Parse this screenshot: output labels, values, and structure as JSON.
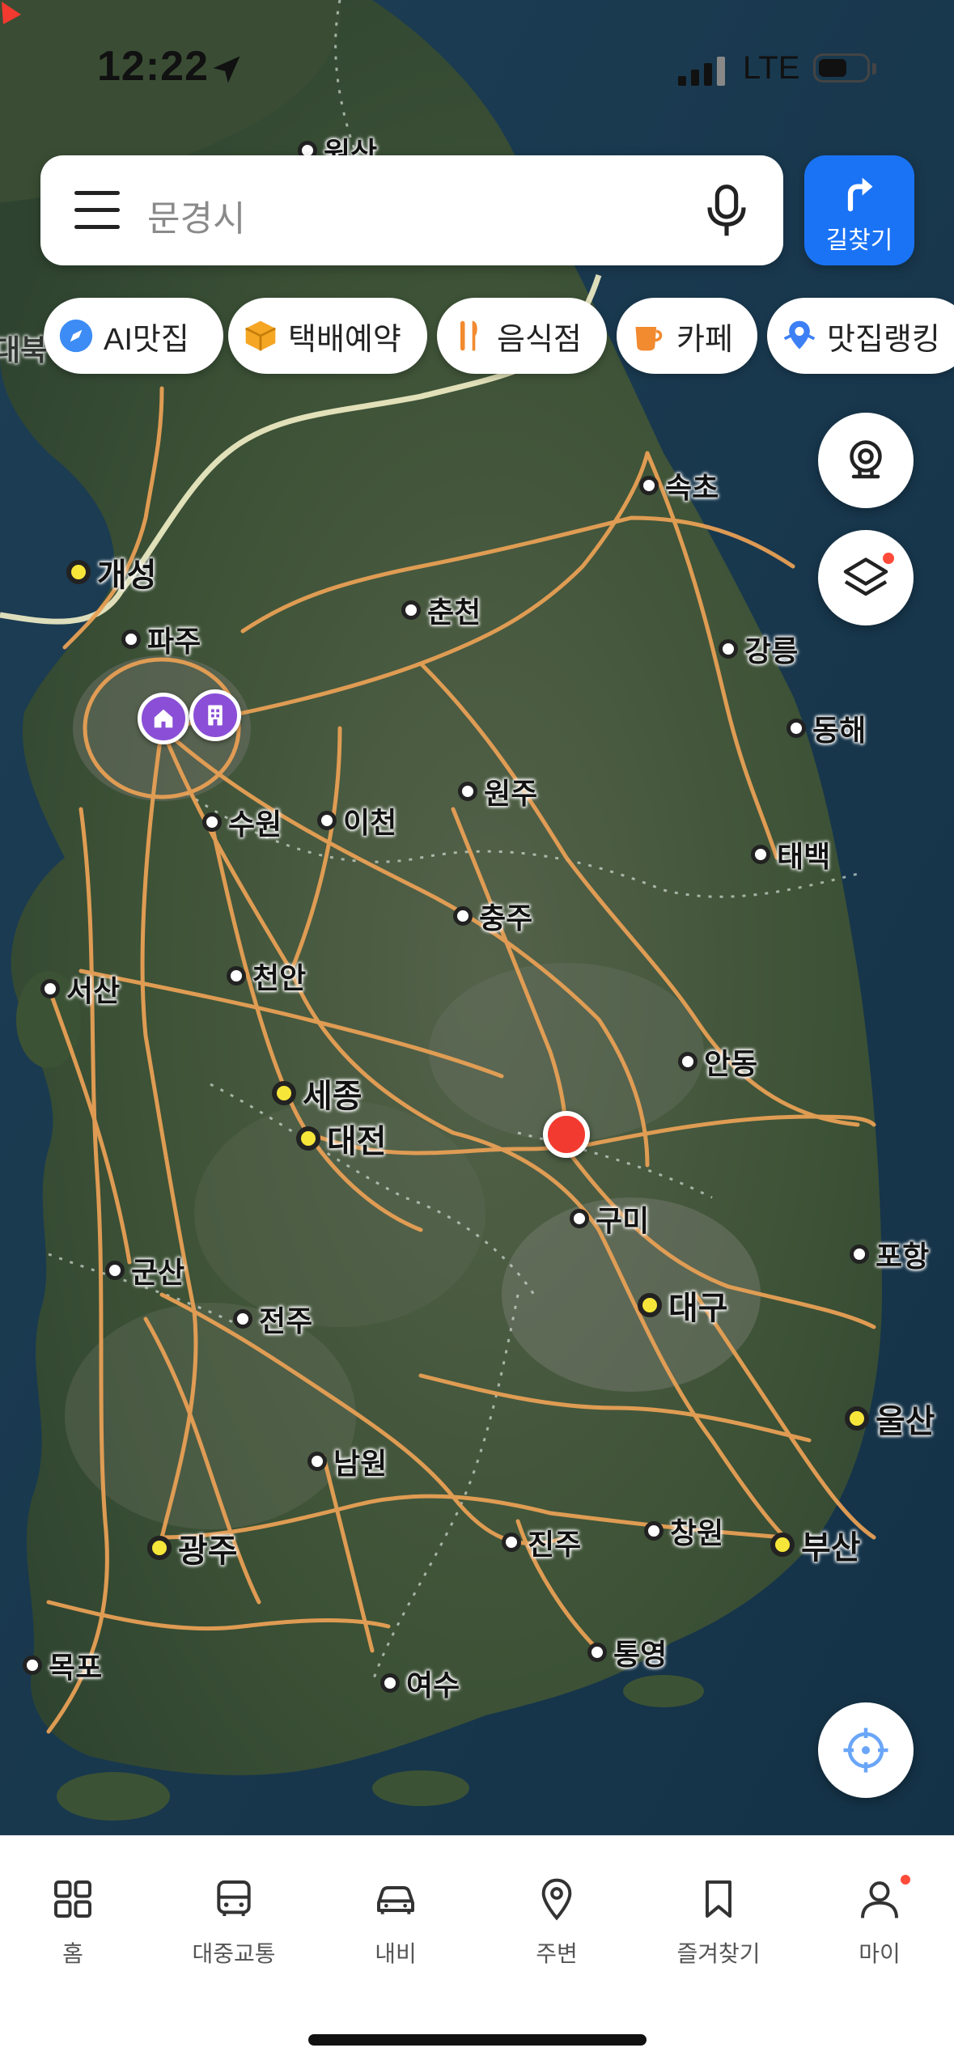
{
  "status_bar": {
    "time": "12:22",
    "network": "LTE"
  },
  "search": {
    "query": "문경시"
  },
  "route_button": {
    "label": "길찾기"
  },
  "chips": [
    {
      "label": "AI맛집",
      "icon": "compass-icon"
    },
    {
      "label": "택배예약",
      "icon": "box-icon"
    },
    {
      "label": "음식점",
      "icon": "utensils-icon"
    },
    {
      "label": "카페",
      "icon": "coffee-cup-icon"
    },
    {
      "label": "맛집랭킹",
      "icon": "ranking-pin-icon"
    }
  ],
  "map": {
    "cities": [
      {
        "name": "원산"
      },
      {
        "name": "속초"
      },
      {
        "name": "개성"
      },
      {
        "name": "춘천"
      },
      {
        "name": "파주"
      },
      {
        "name": "강릉"
      },
      {
        "name": "동해"
      },
      {
        "name": "원주"
      },
      {
        "name": "수원"
      },
      {
        "name": "이천"
      },
      {
        "name": "태백"
      },
      {
        "name": "충주"
      },
      {
        "name": "서산"
      },
      {
        "name": "천안"
      },
      {
        "name": "안동"
      },
      {
        "name": "세종"
      },
      {
        "name": "대전"
      },
      {
        "name": "구미"
      },
      {
        "name": "포항"
      },
      {
        "name": "군산"
      },
      {
        "name": "대구"
      },
      {
        "name": "전주"
      },
      {
        "name": "울산"
      },
      {
        "name": "남원"
      },
      {
        "name": "광주"
      },
      {
        "name": "진주"
      },
      {
        "name": "창원"
      },
      {
        "name": "부산"
      },
      {
        "name": "통영"
      },
      {
        "name": "목포"
      },
      {
        "name": "여수"
      },
      {
        "name": "대북"
      }
    ]
  },
  "tabs": [
    {
      "label": "홈",
      "icon": "grid-icon"
    },
    {
      "label": "대중교통",
      "icon": "bus-icon"
    },
    {
      "label": "내비",
      "icon": "car-icon"
    },
    {
      "label": "주변",
      "icon": "location-pin-icon"
    },
    {
      "label": "즐겨찾기",
      "icon": "bookmark-icon"
    },
    {
      "label": "마이",
      "icon": "person-icon"
    }
  ],
  "colors": {
    "accent": "#1a73f5",
    "road": "#e8a055",
    "current_location": "#f23a30",
    "place_pin": "#8a4fd6"
  }
}
